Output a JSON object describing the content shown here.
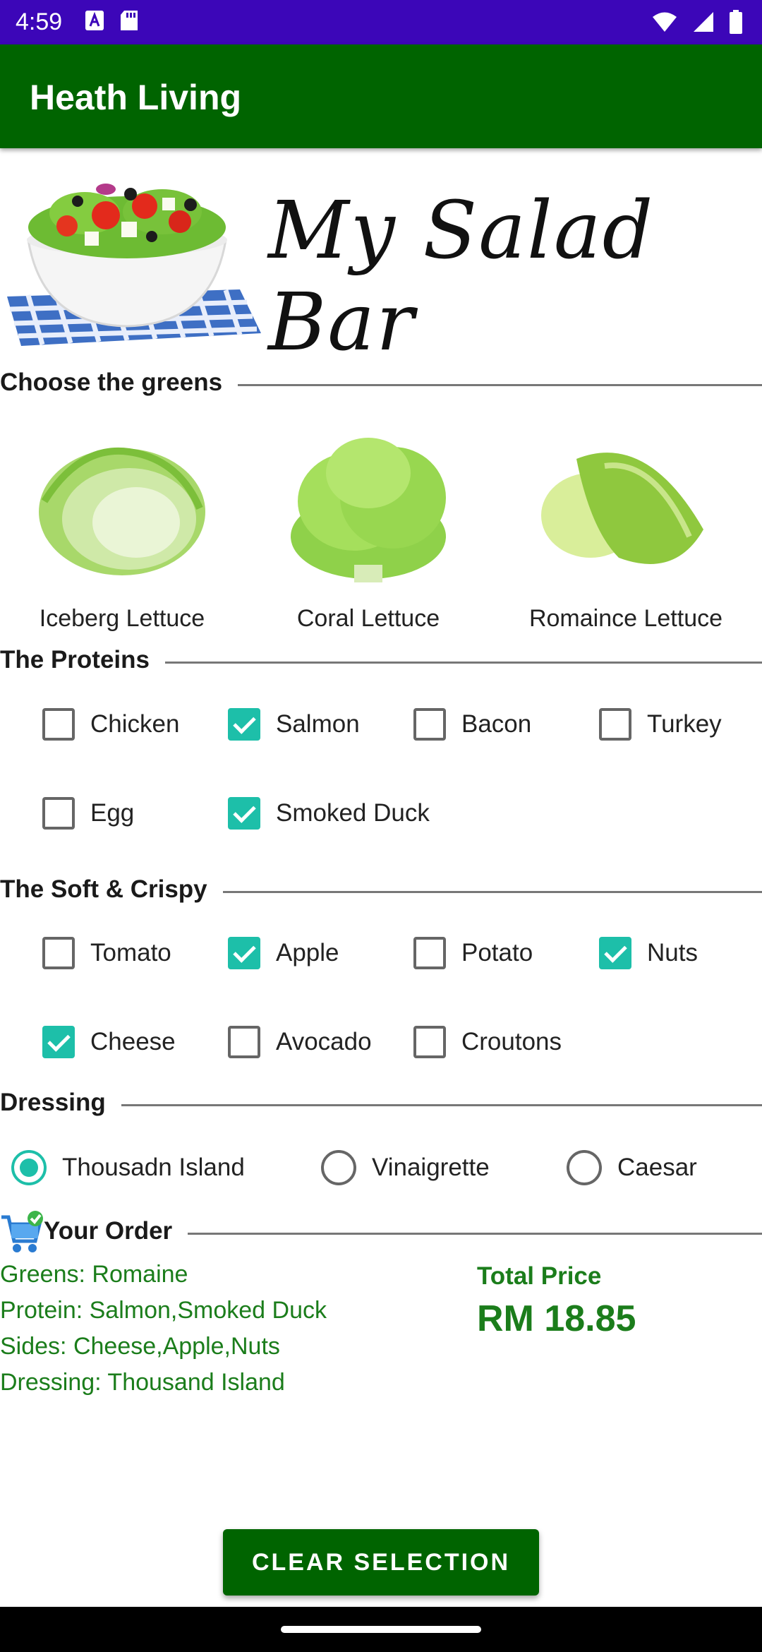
{
  "status_bar": {
    "time": "4:59",
    "icons": [
      "a-icon",
      "sd-card-icon",
      "wifi-icon",
      "signal-icon",
      "battery-icon"
    ]
  },
  "app_bar": {
    "title": "Heath Living"
  },
  "banner": {
    "title": "My Salad Bar"
  },
  "sections": {
    "greens": "Choose the greens",
    "proteins": "The Proteins",
    "soft_crispy": "The Soft & Crispy",
    "dressing": "Dressing",
    "order": "Your Order"
  },
  "greens": [
    {
      "label": "Iceberg Lettuce"
    },
    {
      "label": "Coral Lettuce"
    },
    {
      "label": "Romaince Lettuce"
    }
  ],
  "proteins": [
    {
      "label": "Chicken",
      "checked": false
    },
    {
      "label": "Salmon",
      "checked": true
    },
    {
      "label": "Bacon",
      "checked": false
    },
    {
      "label": "Turkey",
      "checked": false
    },
    {
      "label": "Egg",
      "checked": false
    },
    {
      "label": "Smoked Duck",
      "checked": true
    }
  ],
  "sides": [
    {
      "label": "Tomato",
      "checked": false
    },
    {
      "label": "Apple",
      "checked": true
    },
    {
      "label": "Potato",
      "checked": false
    },
    {
      "label": "Nuts",
      "checked": true
    },
    {
      "label": "Cheese",
      "checked": true
    },
    {
      "label": "Avocado",
      "checked": false
    },
    {
      "label": "Croutons",
      "checked": false
    }
  ],
  "dressing": [
    {
      "label": "Thousadn Island",
      "selected": true
    },
    {
      "label": "Vinaigrette",
      "selected": false
    },
    {
      "label": "Caesar",
      "selected": false
    }
  ],
  "order": {
    "greens": "Greens: Romaine",
    "protein": "Protein: Salmon,Smoked Duck",
    "sides": "Sides: Cheese,Apple,Nuts",
    "dressing": "Dressing: Thousand Island",
    "total_label": "Total Price",
    "total_value": "RM 18.85"
  },
  "clear_button": {
    "label": "CLEAR SELECTION"
  },
  "colors": {
    "status_bar": "#3c06b8",
    "app_bar": "#006400",
    "accent": "#1dbfa9",
    "order_text": "#1b7d1b"
  }
}
